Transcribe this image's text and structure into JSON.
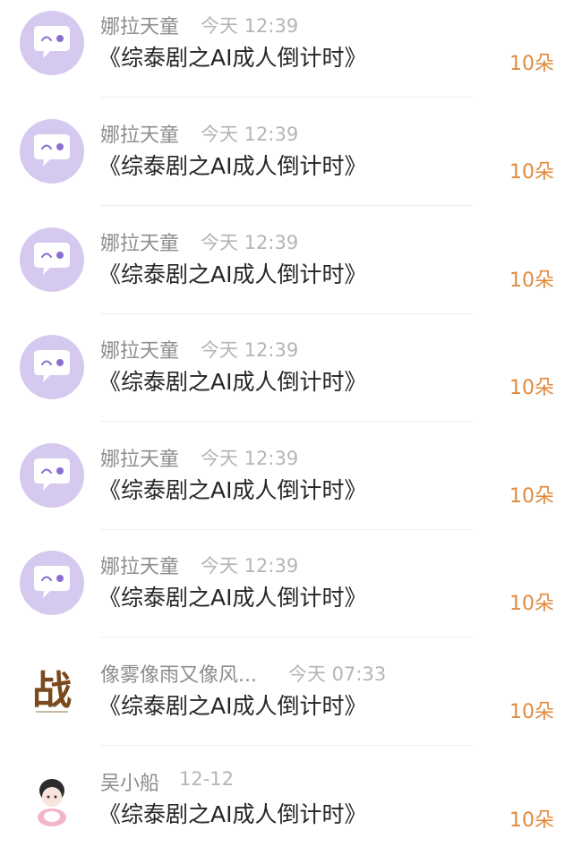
{
  "messages": [
    {
      "sender": "娜拉天童",
      "time": "今天 12:39",
      "title": "《综泰剧之AI成人倒计时》",
      "count": "10朵",
      "avatar": "default-chat-avatar"
    },
    {
      "sender": "娜拉天童",
      "time": "今天 12:39",
      "title": "《综泰剧之AI成人倒计时》",
      "count": "10朵",
      "avatar": "default-chat-avatar"
    },
    {
      "sender": "娜拉天童",
      "time": "今天 12:39",
      "title": "《综泰剧之AI成人倒计时》",
      "count": "10朵",
      "avatar": "default-chat-avatar"
    },
    {
      "sender": "娜拉天童",
      "time": "今天 12:39",
      "title": "《综泰剧之AI成人倒计时》",
      "count": "10朵",
      "avatar": "default-chat-avatar"
    },
    {
      "sender": "娜拉天童",
      "time": "今天 12:39",
      "title": "《综泰剧之AI成人倒计时》",
      "count": "10朵",
      "avatar": "default-chat-avatar"
    },
    {
      "sender": "娜拉天童",
      "time": "今天 12:39",
      "title": "《综泰剧之AI成人倒计时》",
      "count": "10朵",
      "avatar": "default-chat-avatar"
    },
    {
      "sender": "像雾像雨又像风...",
      "time": "今天 07:33",
      "title": "《综泰剧之AI成人倒计时》",
      "count": "10朵",
      "avatar": "calligraphy-avatar",
      "avatar_text": "战"
    },
    {
      "sender": "吴小船",
      "time": "12-12",
      "title": "《综泰剧之AI成人倒计时》",
      "count": "10朵",
      "avatar": "cartoon-character-avatar"
    }
  ],
  "colors": {
    "accent": "#e08a3e",
    "avatar_bg": "#d5c9ef",
    "avatar_accent": "#8b6fd0",
    "name": "#8d8d8d",
    "time": "#b5b5b5",
    "title": "#262626"
  }
}
